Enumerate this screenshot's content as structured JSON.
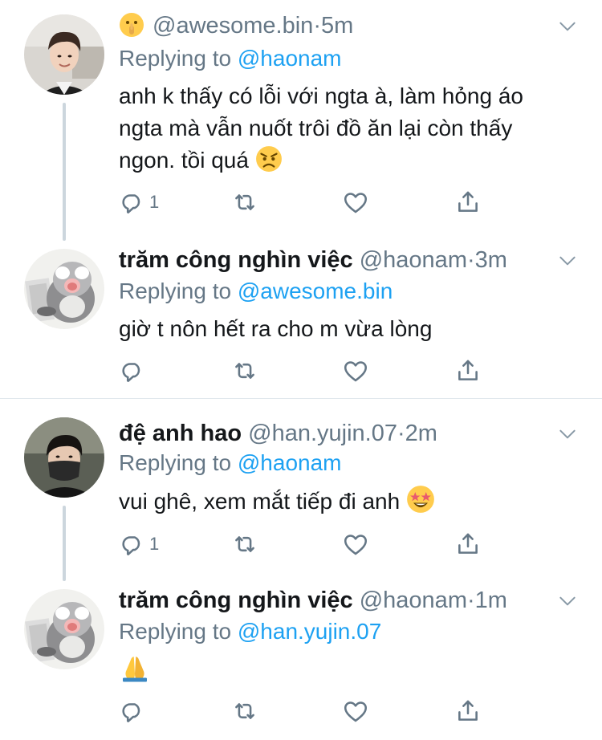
{
  "tweets": [
    {
      "display_name": "",
      "handle": "@awesome.bin",
      "sep": "·",
      "time": "5m",
      "replying_prefix": "Replying to",
      "replying_to": "@haonam",
      "text_lines": [
        "anh k thấy có lỗi với ngta à, làm hỏng áo",
        "ngta mà vẫn nuốt trôi đồ ăn lại còn thấy",
        "ngon. tồi quá"
      ],
      "reply_count": "1",
      "name_emoji": "shushing-face",
      "text_emoji": "angry-face"
    },
    {
      "display_name": "trăm công nghìn việc",
      "handle": "@haonam",
      "sep": "·",
      "time": "3m",
      "replying_prefix": "Replying to",
      "replying_to": "@awesome.bin",
      "text_lines": [
        "giờ t nôn hết ra cho m vừa lòng"
      ],
      "reply_count": ""
    },
    {
      "display_name": "đệ anh hao",
      "handle": "@han.yujin.07",
      "sep": "·",
      "time": "2m",
      "replying_prefix": "Replying to",
      "replying_to": "@haonam",
      "text_lines": [
        "vui ghê, xem mắt tiếp đi anh"
      ],
      "reply_count": "1",
      "text_emoji": "star-struck"
    },
    {
      "display_name": "trăm công nghìn việc",
      "handle": "@haonam",
      "sep": "·",
      "time": "1m",
      "replying_prefix": "Replying to",
      "replying_to": "@han.yujin.07",
      "text_lines": [
        ""
      ],
      "reply_count": "",
      "text_emoji": "folded-hands"
    }
  ],
  "colors": {
    "link": "#1da1f2",
    "secondary": "#657786",
    "thread_line": "#ccd6dd",
    "divider": "#e1e8ed"
  }
}
